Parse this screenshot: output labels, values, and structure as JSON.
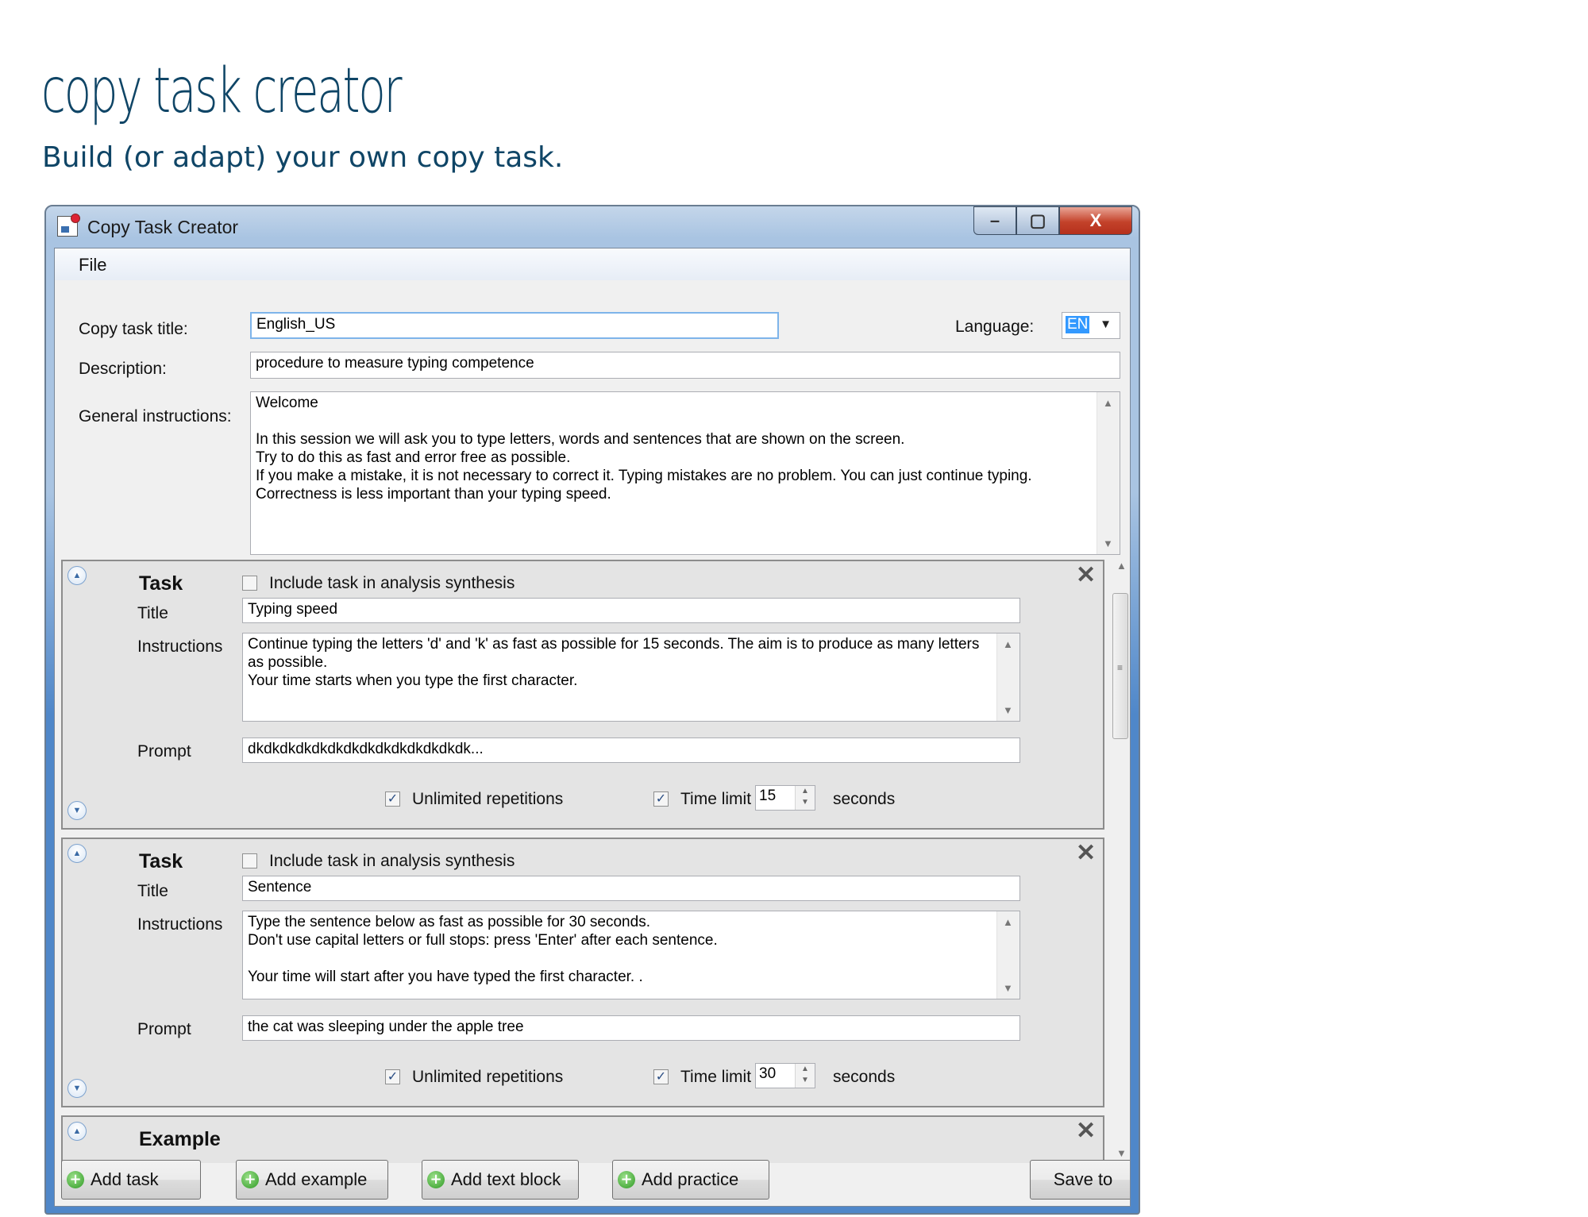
{
  "page": {
    "heading": "copy task creator",
    "subheading": "Build (or adapt) your own copy task."
  },
  "window": {
    "title": "Copy Task Creator",
    "caption_buttons": {
      "minimize": "–",
      "maximize": "▢",
      "close": "X"
    },
    "menu": {
      "file": "File"
    }
  },
  "form": {
    "title_label": "Copy task title:",
    "title_value": "English_US",
    "language_label": "Language:",
    "language_value": "EN",
    "description_label": "Description:",
    "description_value": "procedure to measure typing competence",
    "instructions_label": "General instructions:",
    "instructions_value": "Welcome\n\nIn this session we will ask you to type letters, words and sentences that are shown on the screen.\nTry to do this as fast and error free as possible.\nIf you make a mistake, it is not necessary to correct it. Typing mistakes are no problem. You can just continue typing.\nCorrectness is less important than your typing speed."
  },
  "tasks": [
    {
      "heading": "Task",
      "include_label": "Include task in analysis synthesis",
      "include_checked": false,
      "title_label": "Title",
      "title_value": "Typing speed",
      "instructions_label": "Instructions",
      "instructions_value": "Continue typing the letters 'd' and 'k' as fast as possible for 15 seconds. The aim is to produce as many letters as possible.\nYour time starts when you type the first character.",
      "prompt_label": "Prompt",
      "prompt_value": "dkdkdkdkdkdkdkdkdkdkdkdkdkdk...",
      "unlimited_label": "Unlimited repetitions",
      "unlimited_checked": true,
      "timelimit_label": "Time limit",
      "timelimit_checked": true,
      "timelimit_value": "15",
      "seconds_label": "seconds"
    },
    {
      "heading": "Task",
      "include_label": "Include task in analysis synthesis",
      "include_checked": false,
      "title_label": "Title",
      "title_value": "Sentence",
      "instructions_label": "Instructions",
      "instructions_value": "Type the sentence below as fast as possible for 30 seconds.\nDon't use capital letters or full stops: press 'Enter' after each sentence.\n\nYour time will start after you have typed the first character. .",
      "prompt_label": "Prompt",
      "prompt_value": "the cat was sleeping under the apple tree",
      "unlimited_label": "Unlimited repetitions",
      "unlimited_checked": true,
      "timelimit_label": "Time limit",
      "timelimit_checked": true,
      "timelimit_value": "30",
      "seconds_label": "seconds"
    }
  ],
  "example_panel": {
    "heading": "Example"
  },
  "buttons": {
    "add_task": "Add task",
    "add_example": "Add example",
    "add_text_block": "Add text block",
    "add_practice": "Add practice",
    "save_to": "Save to"
  },
  "icons": {
    "collapse": "chevron-up-icon",
    "expand": "chevron-down-icon",
    "remove": "close-icon",
    "add": "plus-icon",
    "check": "✓"
  }
}
